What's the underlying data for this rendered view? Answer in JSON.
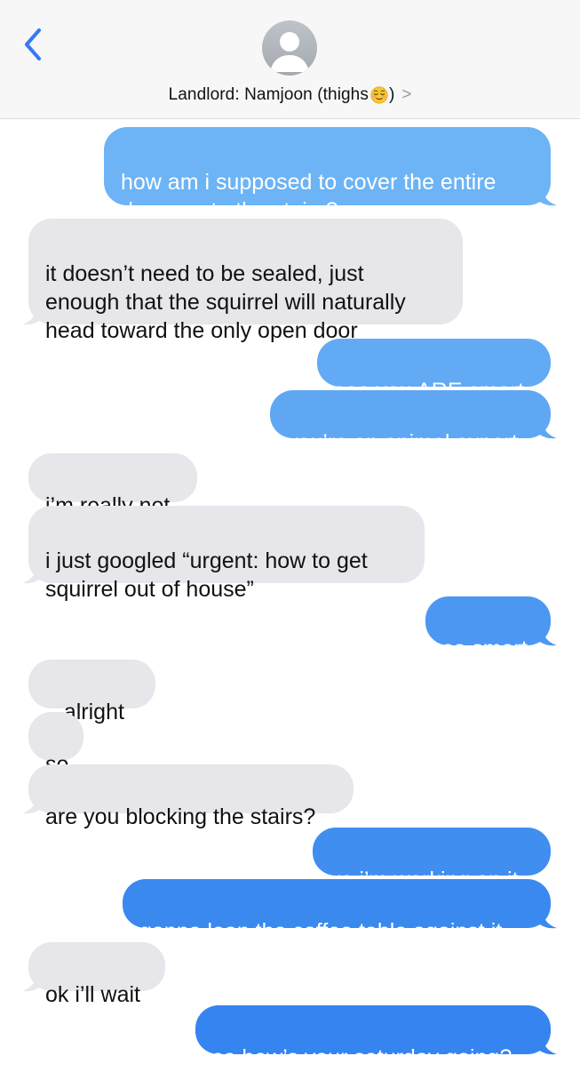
{
  "header": {
    "back_icon": "chevron-left-icon",
    "avatar_icon": "person-silhouette-icon",
    "contact_name": "Landlord: Namjoon (thighs",
    "contact_emoji": "relieved-face-emoji",
    "contact_close": ")",
    "chevron": ">",
    "accent_color": "#3478f6"
  },
  "messages": [
    {
      "id": "m1",
      "side": "sent",
      "text": "how am i supposed to cover the entire\ndoorway to the stairs?",
      "color": "#6cb4f5"
    },
    {
      "id": "m2",
      "side": "received",
      "text": "it doesn’t need to be sealed, just\nenough that the squirrel will naturally\nhead toward the only open door"
    },
    {
      "id": "m3",
      "side": "sent",
      "text": "see you ARE smart",
      "color": "#62aaf3"
    },
    {
      "id": "m4",
      "side": "sent",
      "text": "you’re an animal expert",
      "color": "#5fa7f3"
    },
    {
      "id": "m5",
      "side": "received",
      "text": "i’m really not"
    },
    {
      "id": "m6",
      "side": "received",
      "text": "i just googled “urgent: how to get\nsquirrel out of house”"
    },
    {
      "id": "m7",
      "side": "sent",
      "text": "so smart",
      "color": "#4c97f2"
    },
    {
      "id": "m8",
      "side": "received",
      "text": ".. alright"
    },
    {
      "id": "m9",
      "side": "received",
      "text": "so"
    },
    {
      "id": "m10",
      "side": "received",
      "text": "are you blocking the stairs?"
    },
    {
      "id": "m11",
      "side": "sent",
      "text": "ya i’m working on it",
      "color": "#3f8ef0"
    },
    {
      "id": "m12",
      "side": "sent",
      "text": "gonna lean the coffee table against it",
      "color": "#3a89ef"
    },
    {
      "id": "m13",
      "side": "received",
      "text": "ok i’ll wait"
    },
    {
      "id": "m14",
      "side": "sent",
      "text": "so how’s your saturday going?",
      "color": "#3584ef"
    }
  ],
  "colors": {
    "received_bubble": "#e6e6eb",
    "received_text": "#111111",
    "sent_text": "#ffffff"
  }
}
